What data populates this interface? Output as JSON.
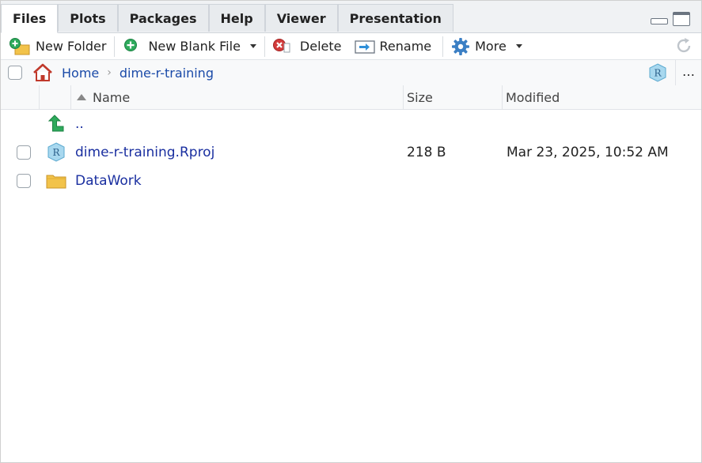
{
  "tabs": [
    {
      "label": "Files",
      "active": true
    },
    {
      "label": "Plots",
      "active": false
    },
    {
      "label": "Packages",
      "active": false
    },
    {
      "label": "Help",
      "active": false
    },
    {
      "label": "Viewer",
      "active": false
    },
    {
      "label": "Presentation",
      "active": false
    }
  ],
  "toolbar": {
    "new_folder": "New Folder",
    "new_blank_file": "New Blank File",
    "delete": "Delete",
    "rename": "Rename",
    "more": "More"
  },
  "breadcrumb": {
    "home": "Home",
    "current": "dime-r-training"
  },
  "columns": {
    "name": "Name",
    "size": "Size",
    "modified": "Modified"
  },
  "files": [
    {
      "name": "..",
      "size": "",
      "modified": "",
      "type": "parent"
    },
    {
      "name": "dime-r-training.Rproj",
      "size": "218 B",
      "modified": "Mar 23, 2025, 10:52 AM",
      "type": "rproj"
    },
    {
      "name": "DataWork",
      "size": "",
      "modified": "",
      "type": "folder"
    }
  ],
  "colors": {
    "link": "#1a4aa8",
    "filename": "#1a2fa0",
    "home_icon": "#c0392b",
    "up_arrow": "#2eaa5c",
    "folder": "#f2c34a",
    "delete_icon": "#d23b3b",
    "gear": "#3b7fc4"
  },
  "icons": {
    "new_folder": "folder-plus-icon",
    "new_file": "plus-circle-icon",
    "delete": "delete-icon",
    "rename": "rename-icon",
    "more": "gear-icon",
    "refresh": "refresh-icon",
    "home": "home-icon",
    "project": "r-project-icon"
  }
}
